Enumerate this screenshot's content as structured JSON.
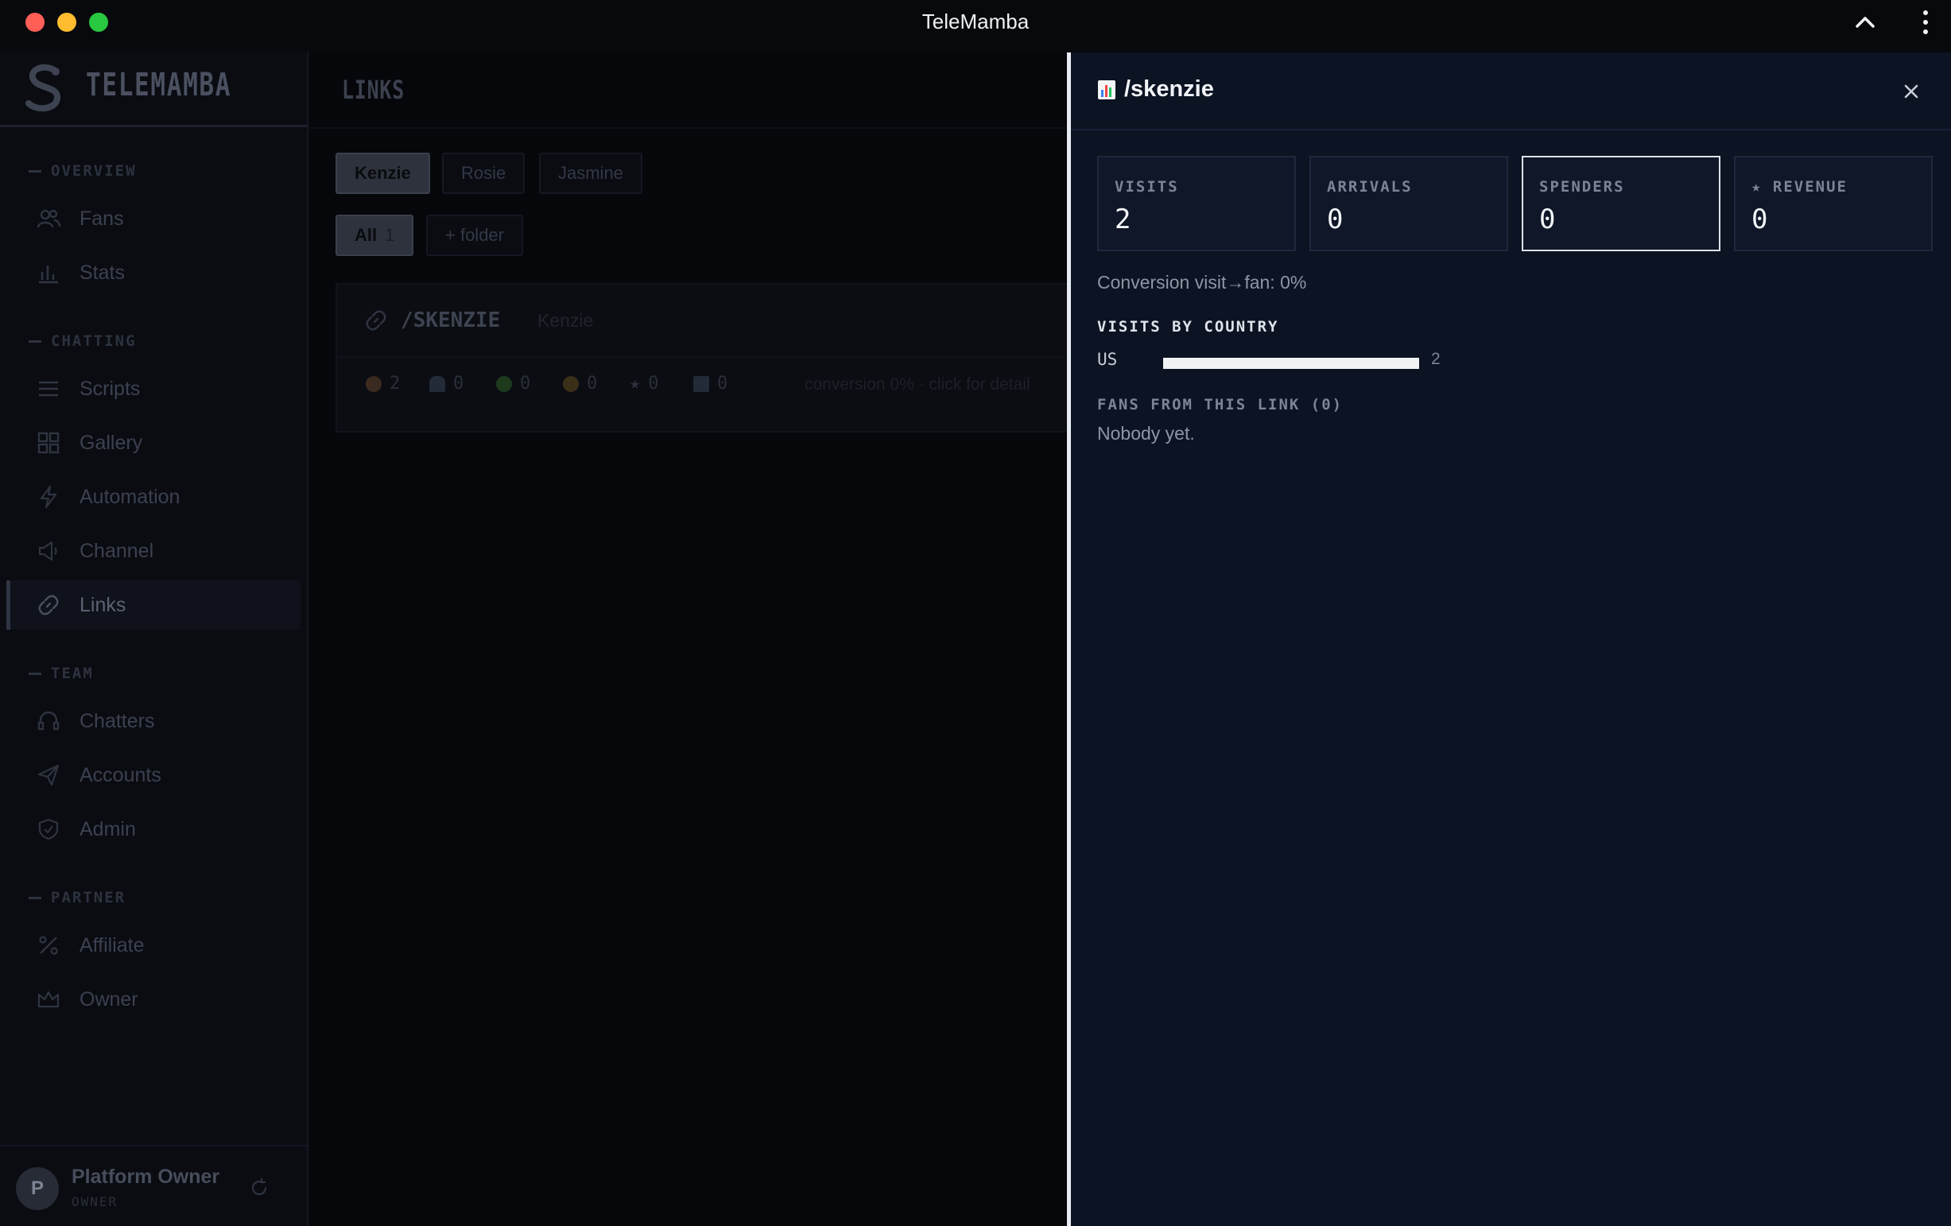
{
  "window": {
    "title": "TeleMamba"
  },
  "sidebar": {
    "brand": "TELEMAMBA",
    "sections": {
      "overview": "OVERVIEW",
      "chatting": "CHATTING",
      "team": "TEAM",
      "partner": "PARTNER"
    },
    "items": {
      "fans": "Fans",
      "stats": "Stats",
      "scripts": "Scripts",
      "gallery": "Gallery",
      "automation": "Automation",
      "channel": "Channel",
      "links": "Links",
      "chatters": "Chatters",
      "accounts": "Accounts",
      "admin": "Admin",
      "affiliate": "Affiliate",
      "owner": "Owner"
    },
    "active_item": "links",
    "user": {
      "initial": "P",
      "name": "Platform Owner",
      "role": "OWNER"
    }
  },
  "main": {
    "title": "LINKS",
    "models": [
      "Kenzie",
      "Rosie",
      "Jasmine"
    ],
    "selected_model": "Kenzie",
    "folders": {
      "all_label": "All",
      "all_count": "1",
      "add_label": "+ folder"
    },
    "link": {
      "name": "/SKENZIE",
      "model": "Kenzie",
      "stats": [
        "2",
        "0",
        "0",
        "0",
        "0",
        "0"
      ],
      "conversion_text": "conversion 0% · click for detail"
    }
  },
  "panel": {
    "title": "/skenzie",
    "kpis": {
      "visits_label": "VISITS",
      "visits_value": "2",
      "arrivals_label": "ARRIVALS",
      "arrivals_value": "0",
      "spenders_label": "SPENDERS",
      "spenders_value": "0",
      "revenue_label": "★ REVENUE",
      "revenue_value": "0"
    },
    "conversion": "Conversion visit→fan: 0%",
    "visits_by_country_label": "VISITS BY COUNTRY",
    "countries": [
      {
        "code": "US",
        "visits": "2",
        "share": 1.0
      }
    ],
    "fans_label": "FANS FROM THIS LINK (0)",
    "fans_empty": "Nobody yet."
  },
  "colors": {
    "accent": "#f0f2f6",
    "panel_bg": "#0c1322"
  }
}
